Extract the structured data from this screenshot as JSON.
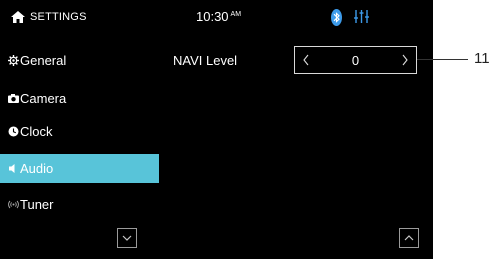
{
  "header": {
    "title": "SETTINGS",
    "time": "10:30",
    "ampm": "AM",
    "icons": [
      "home-icon",
      "bluetooth-icon",
      "equalizer-icon"
    ],
    "bluetooth_color": "#3d9bea",
    "equalizer_color": "#3d9bea"
  },
  "sidebar": {
    "items": [
      {
        "label": "General",
        "icon": "gear-icon",
        "active": false
      },
      {
        "label": "Camera",
        "icon": "camera-icon",
        "active": false
      },
      {
        "label": "Clock",
        "icon": "clock-icon",
        "active": false
      },
      {
        "label": "Audio",
        "icon": "speaker-icon",
        "active": true
      },
      {
        "label": "Tuner",
        "icon": "radio-wave-icon",
        "active": false
      }
    ],
    "active_color": "#58c4d9"
  },
  "main": {
    "navi_level": {
      "label": "NAVI Level",
      "value": "0"
    }
  },
  "callout": {
    "number": "11"
  }
}
